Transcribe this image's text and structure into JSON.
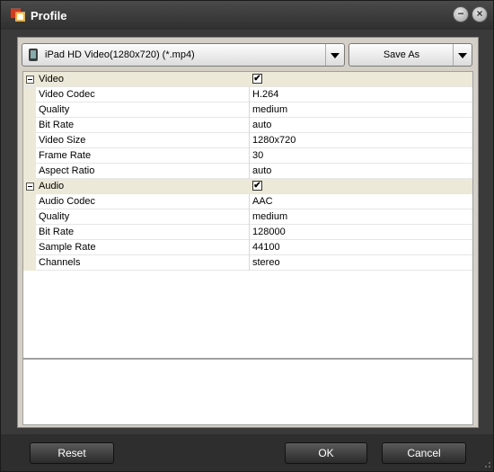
{
  "window": {
    "title": "Profile",
    "minimize_label": "−",
    "close_label": "×"
  },
  "toolbar": {
    "profile_value": "iPad HD Video(1280x720) (*.mp4)",
    "save_as_label": "Save As"
  },
  "properties": [
    {
      "type": "category",
      "name": "Video",
      "checked": "✔"
    },
    {
      "type": "item",
      "name": "Video Codec",
      "value": "H.264"
    },
    {
      "type": "item",
      "name": "Quality",
      "value": "medium"
    },
    {
      "type": "item",
      "name": "Bit Rate",
      "value": "auto"
    },
    {
      "type": "item",
      "name": "Video Size",
      "value": "1280x720"
    },
    {
      "type": "item",
      "name": "Frame Rate",
      "value": "30"
    },
    {
      "type": "item",
      "name": "Aspect Ratio",
      "value": "auto"
    },
    {
      "type": "category",
      "name": "Audio",
      "checked": "✔"
    },
    {
      "type": "item",
      "name": "Audio Codec",
      "value": "AAC"
    },
    {
      "type": "item",
      "name": "Quality",
      "value": "medium"
    },
    {
      "type": "item",
      "name": "Bit Rate",
      "value": "128000"
    },
    {
      "type": "item",
      "name": "Sample Rate",
      "value": "44100"
    },
    {
      "type": "item",
      "name": "Channels",
      "value": "stereo"
    }
  ],
  "buttons": {
    "reset": "Reset",
    "ok": "OK",
    "cancel": "Cancel"
  },
  "colors": {
    "titlebar": "#3a3a3a",
    "category_bg": "#ece9d8",
    "button_bg": "#3d3d3d"
  }
}
